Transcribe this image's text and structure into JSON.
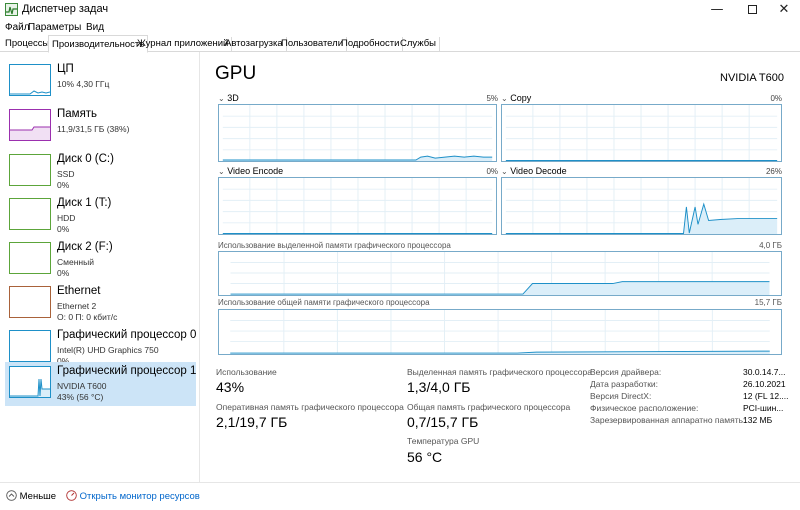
{
  "window": {
    "title": "Диспетчер задач"
  },
  "menu": [
    {
      "label": "Файл"
    },
    {
      "label": "Параметры"
    },
    {
      "label": "Вид"
    }
  ],
  "tabs": [
    {
      "label": "Процессы"
    },
    {
      "label": "Производительность"
    },
    {
      "label": "Журнал приложений"
    },
    {
      "label": "Автозагрузка"
    },
    {
      "label": "Пользователи"
    },
    {
      "label": "Подробности"
    },
    {
      "label": "Службы"
    }
  ],
  "sidebar": {
    "items": [
      {
        "name": "ЦП",
        "line1": "10% 4,30 ГГц",
        "line2": "",
        "color": "#1e90c8"
      },
      {
        "name": "Память",
        "line1": "11,9/31,5 ГБ (38%)",
        "line2": "",
        "color": "#9b2fae"
      },
      {
        "name": "Диск 0 (C:)",
        "line1": "SSD",
        "line2": "0%",
        "color": "#5ca53a"
      },
      {
        "name": "Диск 1 (T:)",
        "line1": "HDD",
        "line2": "0%",
        "color": "#5ca53a"
      },
      {
        "name": "Диск 2 (F:)",
        "line1": "Сменный",
        "line2": "0%",
        "color": "#5ca53a"
      },
      {
        "name": "Ethernet",
        "line1": "Ethernet 2",
        "line2": "О: 0 П: 0 кбит/с",
        "color": "#a9623a"
      },
      {
        "name": "Графический процессор 0",
        "line1": "Intel(R) UHD Graphics 750",
        "line2": "0%",
        "color": "#1e90c8"
      },
      {
        "name": "Графический процессор 1",
        "line1": "NVIDIA T600",
        "line2": "43% (56 °C)",
        "color": "#1e90c8"
      }
    ]
  },
  "main": {
    "title": "GPU",
    "model": "NVIDIA T600",
    "graphs": [
      {
        "label": "3D",
        "pct": "5%"
      },
      {
        "label": "Copy",
        "pct": "0%"
      },
      {
        "label": "Video Encode",
        "pct": "0%"
      },
      {
        "label": "Video Decode",
        "pct": "26%"
      }
    ],
    "dedicated": {
      "label": "Использование выделенной памяти графического процессора",
      "max": "4,0 ГБ"
    },
    "shared": {
      "label": "Использование общей памяти графического процессора",
      "max": "15,7 ГБ"
    },
    "accent": "#1e90c8"
  },
  "stats": {
    "usage_label": "Использование",
    "usage_value": "43%",
    "gpu_mem_label": "Оперативная память графического процессора",
    "gpu_mem_value": "2,1/19,7 ГБ",
    "dedicated_label": "Выделенная память графического процессора",
    "dedicated_value": "1,3/4,0 ГБ",
    "shared_label": "Общая память графического процессора",
    "shared_value": "0,7/15,7 ГБ",
    "temp_label": "Температура GPU",
    "temp_value": "56 °C"
  },
  "info": [
    {
      "k": "Версия драйвера:",
      "v": "30.0.14.7..."
    },
    {
      "k": "Дата разработки:",
      "v": "26.10.2021"
    },
    {
      "k": "Версия DirectX:",
      "v": "12 (FL 12...."
    },
    {
      "k": "Физическое расположение:",
      "v": "PCI-шин..."
    },
    {
      "k": "Зарезервированная аппаратно память:",
      "v": "132 МБ"
    }
  ],
  "footer": {
    "less": "Меньше",
    "monitor": "Открыть монитор ресурсов"
  }
}
